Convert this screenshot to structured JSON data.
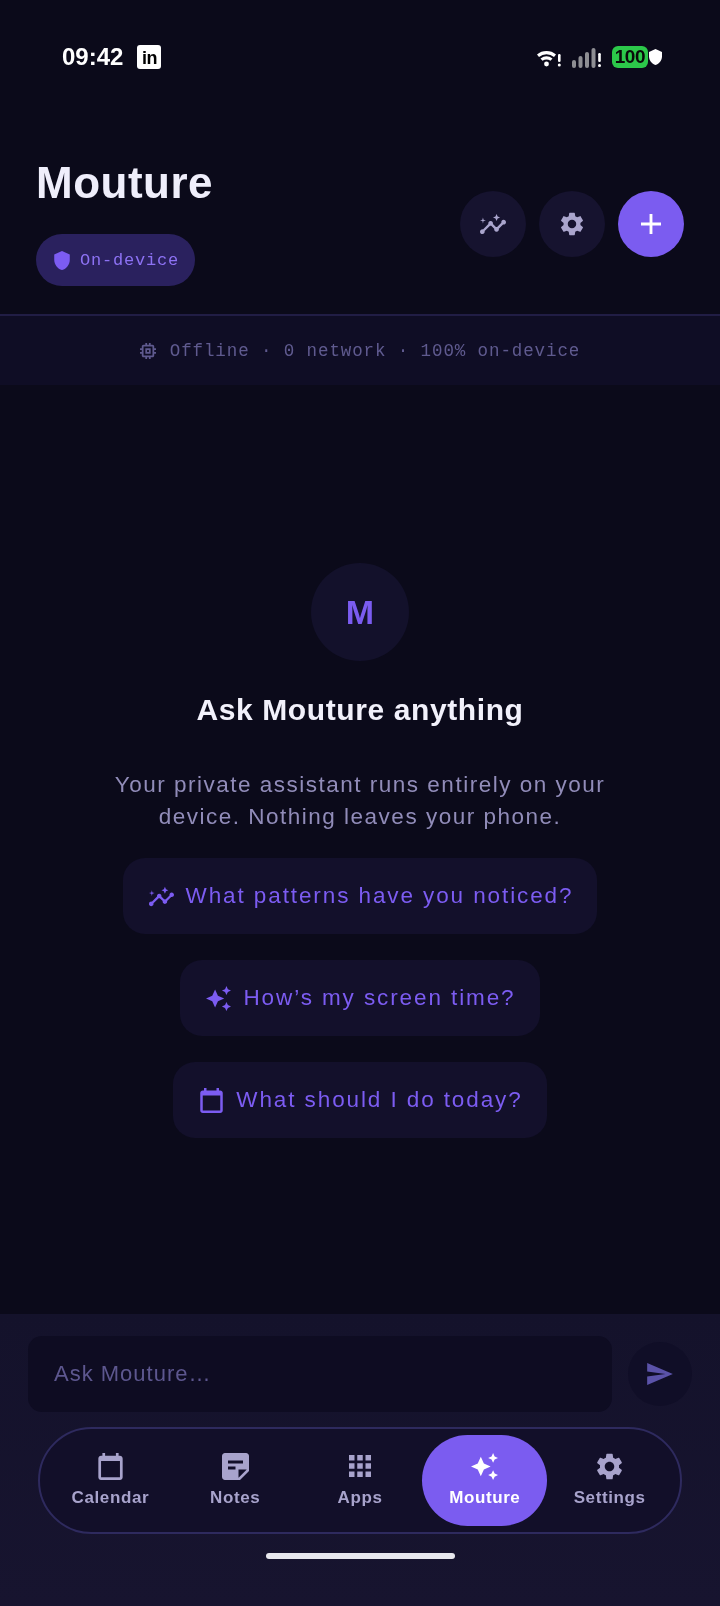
{
  "status_bar": {
    "time": "09:42",
    "notification": "in",
    "battery": "100"
  },
  "header": {
    "title": "Mouture",
    "badge": "On-device",
    "actions": [
      {
        "kind": "insights"
      },
      {
        "kind": "settings"
      },
      {
        "kind": "add"
      }
    ]
  },
  "banner": {
    "text": "Offline · 0 network · 100% on-device"
  },
  "empty_state": {
    "avatar": "M",
    "title": "Ask Mouture anything",
    "description": "Your private assistant runs entirely on your device. Nothing leaves your phone."
  },
  "suggestions": [
    {
      "kind": "insights",
      "text": "What patterns have you noticed?"
    },
    {
      "kind": "sparkle",
      "text": "How’s my screen time?"
    },
    {
      "kind": "calendar",
      "text": "What should I do today?"
    }
  ],
  "composer": {
    "placeholder": "Ask Mouture…"
  },
  "tabs": [
    {
      "kind": "calendar",
      "label": "Calendar",
      "selected": false
    },
    {
      "kind": "notes",
      "label": "Notes",
      "selected": false
    },
    {
      "kind": "apps",
      "label": "Apps",
      "selected": false
    },
    {
      "kind": "sparkle",
      "label": "Mouture",
      "selected": true
    },
    {
      "kind": "settings",
      "label": "Settings",
      "selected": false
    }
  ]
}
